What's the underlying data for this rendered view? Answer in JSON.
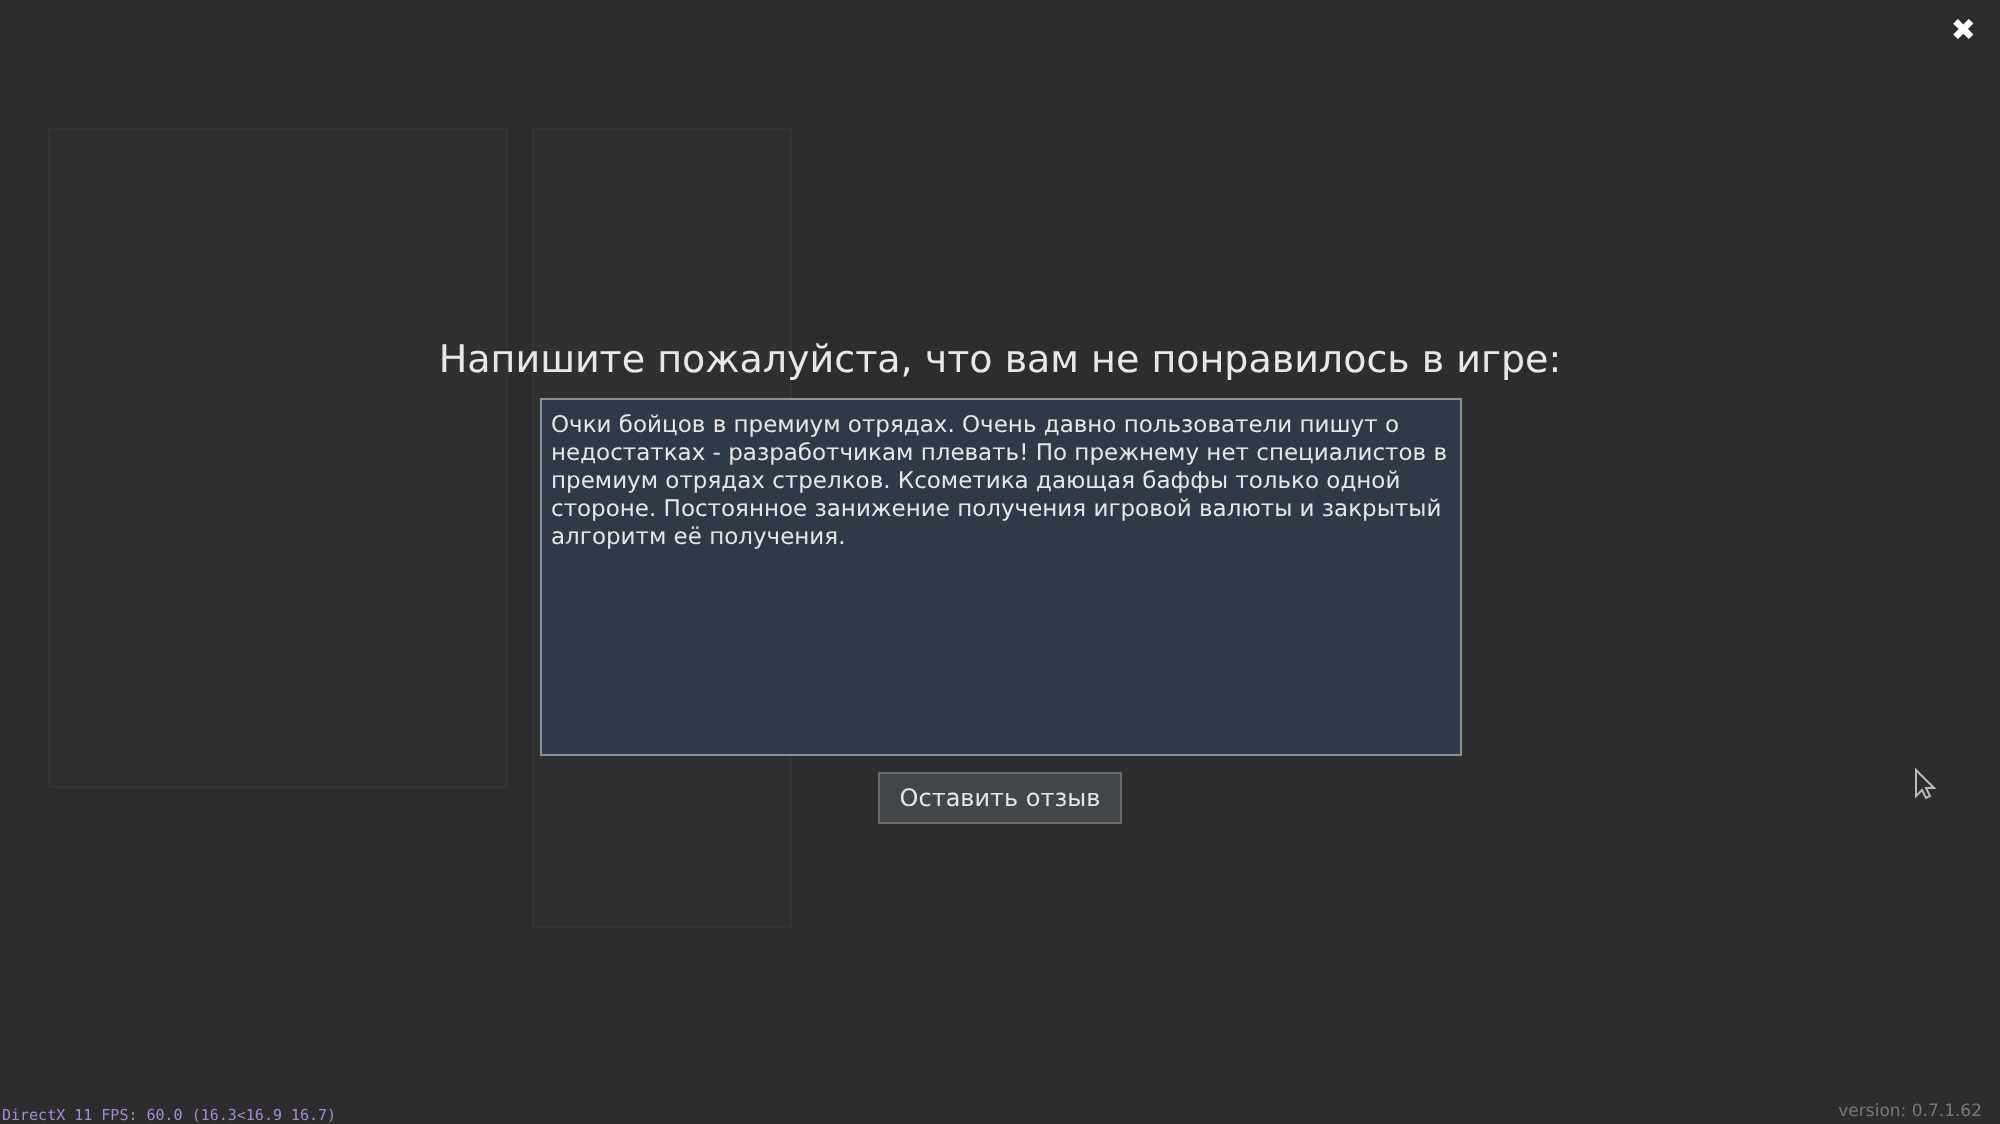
{
  "close_button": {
    "label": "✖"
  },
  "feedback_dialog": {
    "title": "Напишите пожалуйста, что вам не понравилось в игре:",
    "text_field": {
      "value": "Очки бойцов в премиум отрядах. Очень давно пользователи пишут о недостатках - разработчикам плевать! По прежнему нет специалистов в премиум отрядах стрелков. Ксометика дающая баффы только одной стороне. Постоянное занижение получения игровой валюты и закрытый алгоритм её получения."
    },
    "submit_button": {
      "label": "Оставить отзыв"
    }
  },
  "status_bar": {
    "fps": "DirectX 11 FPS: 60.0 (16.3<16.9 16.7)",
    "version": "version: 0.7.1.62"
  }
}
